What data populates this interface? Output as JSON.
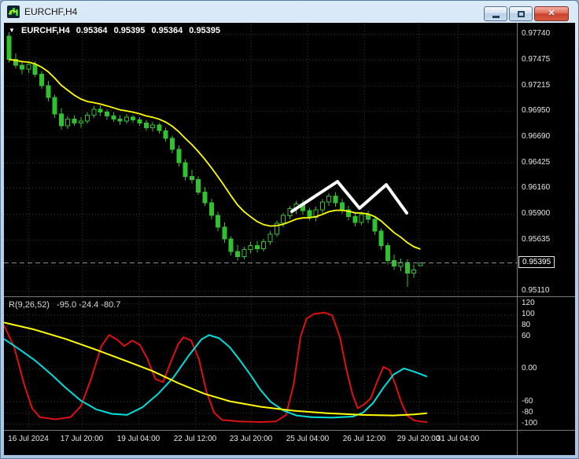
{
  "window": {
    "title": "EURCHF,H4",
    "controls": {
      "minimize": "minimize-button",
      "maximize": "maximize-button",
      "close": "close-button"
    }
  },
  "main_chart": {
    "marker": "▼",
    "symbol_label": "EURCHF,H4",
    "open": "0.95364",
    "high": "0.95395",
    "low": "0.95364",
    "close": "0.95395",
    "current_price_label": "0.95395"
  },
  "indicator_panel": {
    "label": "R(9,26,52)",
    "values": "-95.0 -24.4 -80.7"
  },
  "colors": {
    "bull": "#30c030",
    "ma": "#ffff00",
    "annotation": "#ffffff",
    "ind_fast": "#dd1111",
    "ind_mid": "#00dddd",
    "ind_slow": "#ffff00"
  },
  "chart_data": [
    {
      "type": "candlestick",
      "title": "EURCHF H4",
      "ylim": [
        0.9506,
        0.9784
      ],
      "price_ticks": [
        0.9774,
        0.97475,
        0.97215,
        0.9695,
        0.9669,
        0.96425,
        0.9616,
        0.959,
        0.95635,
        0.9537,
        0.9511
      ],
      "current_price": 0.95395,
      "ma_alpha": 0.15,
      "time_labels": [
        {
          "x": 0.048,
          "label": "16 Jul 2024"
        },
        {
          "x": 0.152,
          "label": "17 Jul 20:00"
        },
        {
          "x": 0.262,
          "label": "19 Jul 04:00"
        },
        {
          "x": 0.372,
          "label": "22 Jul 12:00"
        },
        {
          "x": 0.482,
          "label": "23 Jul 20:00"
        },
        {
          "x": 0.592,
          "label": "25 Jul 04:00"
        },
        {
          "x": 0.702,
          "label": "26 Jul 12:00"
        },
        {
          "x": 0.808,
          "label": "29 Jul 20:00"
        },
        {
          "x": 0.885,
          "label": "31 Jul 04:00"
        }
      ],
      "annotation_zigzag": [
        [
          366,
          238
        ],
        [
          424,
          200
        ],
        [
          452,
          234
        ],
        [
          486,
          204
        ],
        [
          512,
          240
        ]
      ],
      "candles": [
        [
          0.9772,
          0.9776,
          0.9745,
          0.9748
        ],
        [
          0.9748,
          0.9754,
          0.9739,
          0.9742
        ],
        [
          0.9742,
          0.9747,
          0.9733,
          0.9738
        ],
        [
          0.9738,
          0.9745,
          0.9734,
          0.9743
        ],
        [
          0.9743,
          0.9746,
          0.973,
          0.9733
        ],
        [
          0.9733,
          0.9736,
          0.9718,
          0.9721
        ],
        [
          0.9721,
          0.9726,
          0.9705,
          0.9709
        ],
        [
          0.9709,
          0.9712,
          0.9688,
          0.9692
        ],
        [
          0.9692,
          0.9698,
          0.9676,
          0.968
        ],
        [
          0.968,
          0.969,
          0.9677,
          0.9687
        ],
        [
          0.9687,
          0.9691,
          0.968,
          0.9683
        ],
        [
          0.9683,
          0.9689,
          0.9678,
          0.9685
        ],
        [
          0.9685,
          0.9694,
          0.9682,
          0.9691
        ],
        [
          0.9691,
          0.97,
          0.9688,
          0.9697
        ],
        [
          0.9697,
          0.9701,
          0.969,
          0.9694
        ],
        [
          0.9694,
          0.9697,
          0.9686,
          0.969
        ],
        [
          0.969,
          0.9694,
          0.9684,
          0.9687
        ],
        [
          0.9687,
          0.9691,
          0.9681,
          0.9685
        ],
        [
          0.9685,
          0.9692,
          0.9682,
          0.9689
        ],
        [
          0.9689,
          0.9691,
          0.9683,
          0.9686
        ],
        [
          0.9686,
          0.9689,
          0.968,
          0.9683
        ],
        [
          0.9683,
          0.9686,
          0.9675,
          0.9678
        ],
        [
          0.9678,
          0.9684,
          0.9674,
          0.9681
        ],
        [
          0.9681,
          0.9683,
          0.9672,
          0.9675
        ],
        [
          0.9675,
          0.9678,
          0.9664,
          0.9667
        ],
        [
          0.9667,
          0.967,
          0.9652,
          0.9656
        ],
        [
          0.9656,
          0.966,
          0.9638,
          0.9642
        ],
        [
          0.9642,
          0.9646,
          0.9624,
          0.9628
        ],
        [
          0.9628,
          0.9635,
          0.9621,
          0.9625
        ],
        [
          0.9625,
          0.9628,
          0.9609,
          0.9612
        ],
        [
          0.9612,
          0.9617,
          0.9598,
          0.9601
        ],
        [
          0.9601,
          0.9605,
          0.9584,
          0.9588
        ],
        [
          0.9588,
          0.9592,
          0.9572,
          0.9576
        ],
        [
          0.9576,
          0.9581,
          0.956,
          0.9564
        ],
        [
          0.9564,
          0.9567,
          0.9547,
          0.9551
        ],
        [
          0.9551,
          0.9558,
          0.9542,
          0.9546
        ],
        [
          0.9546,
          0.9556,
          0.9543,
          0.9553
        ],
        [
          0.9553,
          0.9561,
          0.9549,
          0.9557
        ],
        [
          0.9557,
          0.9562,
          0.955,
          0.9554
        ],
        [
          0.9554,
          0.9564,
          0.9551,
          0.9561
        ],
        [
          0.9561,
          0.9572,
          0.9558,
          0.9569
        ],
        [
          0.9569,
          0.9583,
          0.9566,
          0.958
        ],
        [
          0.958,
          0.9591,
          0.9576,
          0.9588
        ],
        [
          0.9588,
          0.9598,
          0.9584,
          0.9595
        ],
        [
          0.9595,
          0.9603,
          0.959,
          0.96
        ],
        [
          0.96,
          0.9604,
          0.9589,
          0.9593
        ],
        [
          0.9593,
          0.9596,
          0.9583,
          0.9586
        ],
        [
          0.9586,
          0.9597,
          0.9582,
          0.9594
        ],
        [
          0.9594,
          0.9605,
          0.959,
          0.9602
        ],
        [
          0.9602,
          0.9611,
          0.9598,
          0.9608
        ],
        [
          0.9608,
          0.9612,
          0.9597,
          0.9601
        ],
        [
          0.9601,
          0.9605,
          0.959,
          0.9594
        ],
        [
          0.9594,
          0.9598,
          0.9583,
          0.9587
        ],
        [
          0.9587,
          0.9591,
          0.9577,
          0.9581
        ],
        [
          0.9581,
          0.9592,
          0.9578,
          0.9589
        ],
        [
          0.9589,
          0.9593,
          0.958,
          0.9584
        ],
        [
          0.9584,
          0.9587,
          0.9568,
          0.9572
        ],
        [
          0.9572,
          0.9575,
          0.9553,
          0.9557
        ],
        [
          0.9557,
          0.956,
          0.9538,
          0.9542
        ],
        [
          0.9542,
          0.9548,
          0.9532,
          0.9536
        ],
        [
          0.9536,
          0.9544,
          0.9531,
          0.954
        ],
        [
          0.954,
          0.9543,
          0.9515,
          0.9529
        ],
        [
          0.9529,
          0.9538,
          0.9524,
          0.9532
        ],
        [
          0.95364,
          0.95395,
          0.95364,
          0.95395
        ]
      ]
    },
    {
      "type": "line",
      "title": "R(9,26,52)",
      "current_values": [
        -95.0,
        -24.4,
        -80.7
      ],
      "ylim": [
        -110,
        130
      ],
      "ticks": [
        {
          "value": 120,
          "label": "120"
        },
        {
          "value": 100,
          "label": "100"
        },
        {
          "value": 80,
          "label": "80"
        },
        {
          "value": 60,
          "label": "60"
        },
        {
          "value": 0,
          "label": "0.00"
        },
        {
          "value": -60,
          "label": "-60"
        },
        {
          "value": -80,
          "label": "-80"
        },
        {
          "value": -100,
          "label": "-100"
        }
      ],
      "series": [
        {
          "name": "fast-red",
          "color": "#dd1111",
          "points": [
            [
              0,
              80
            ],
            [
              0.02,
              40
            ],
            [
              0.04,
              -30
            ],
            [
              0.055,
              -72
            ],
            [
              0.07,
              -88
            ],
            [
              0.1,
              -92
            ],
            [
              0.13,
              -88
            ],
            [
              0.15,
              -68
            ],
            [
              0.17,
              -18
            ],
            [
              0.19,
              42
            ],
            [
              0.205,
              62
            ],
            [
              0.22,
              54
            ],
            [
              0.235,
              42
            ],
            [
              0.25,
              52
            ],
            [
              0.265,
              44
            ],
            [
              0.28,
              18
            ],
            [
              0.295,
              -18
            ],
            [
              0.31,
              -24
            ],
            [
              0.325,
              12
            ],
            [
              0.34,
              46
            ],
            [
              0.35,
              58
            ],
            [
              0.365,
              52
            ],
            [
              0.38,
              18
            ],
            [
              0.395,
              -42
            ],
            [
              0.41,
              -80
            ],
            [
              0.425,
              -93
            ],
            [
              0.46,
              -96
            ],
            [
              0.5,
              -97
            ],
            [
              0.53,
              -96
            ],
            [
              0.55,
              -84
            ],
            [
              0.565,
              -28
            ],
            [
              0.578,
              58
            ],
            [
              0.59,
              92
            ],
            [
              0.605,
              101
            ],
            [
              0.625,
              103
            ],
            [
              0.64,
              98
            ],
            [
              0.655,
              58
            ],
            [
              0.668,
              -2
            ],
            [
              0.68,
              -48
            ],
            [
              0.69,
              -72
            ],
            [
              0.703,
              -64
            ],
            [
              0.715,
              -54
            ],
            [
              0.728,
              -22
            ],
            [
              0.74,
              4
            ],
            [
              0.752,
              -2
            ],
            [
              0.763,
              -28
            ],
            [
              0.775,
              -62
            ],
            [
              0.787,
              -86
            ],
            [
              0.8,
              -94
            ],
            [
              0.812,
              -96
            ],
            [
              0.825,
              -97
            ]
          ]
        },
        {
          "name": "mid-cyan",
          "color": "#00dddd",
          "points": [
            [
              0,
              55
            ],
            [
              0.03,
              36
            ],
            [
              0.06,
              16
            ],
            [
              0.09,
              -8
            ],
            [
              0.12,
              -34
            ],
            [
              0.15,
              -58
            ],
            [
              0.18,
              -74
            ],
            [
              0.21,
              -82
            ],
            [
              0.24,
              -84
            ],
            [
              0.27,
              -70
            ],
            [
              0.3,
              -46
            ],
            [
              0.33,
              -16
            ],
            [
              0.36,
              24
            ],
            [
              0.385,
              54
            ],
            [
              0.4,
              62
            ],
            [
              0.42,
              56
            ],
            [
              0.44,
              40
            ],
            [
              0.46,
              16
            ],
            [
              0.48,
              -10
            ],
            [
              0.5,
              -38
            ],
            [
              0.52,
              -60
            ],
            [
              0.545,
              -76
            ],
            [
              0.57,
              -85
            ],
            [
              0.6,
              -88
            ],
            [
              0.64,
              -89
            ],
            [
              0.68,
              -87
            ],
            [
              0.7,
              -80
            ],
            [
              0.72,
              -62
            ],
            [
              0.74,
              -34
            ],
            [
              0.76,
              -10
            ],
            [
              0.78,
              1
            ],
            [
              0.8,
              -5
            ],
            [
              0.825,
              -14
            ]
          ]
        },
        {
          "name": "slow-yellow",
          "color": "#ffff00",
          "points": [
            [
              0,
              85
            ],
            [
              0.06,
              72
            ],
            [
              0.12,
              55
            ],
            [
              0.18,
              35
            ],
            [
              0.24,
              14
            ],
            [
              0.29,
              -4
            ],
            [
              0.34,
              -26
            ],
            [
              0.39,
              -45
            ],
            [
              0.44,
              -59
            ],
            [
              0.5,
              -69
            ],
            [
              0.56,
              -76
            ],
            [
              0.63,
              -81
            ],
            [
              0.7,
              -84
            ],
            [
              0.76,
              -85
            ],
            [
              0.8,
              -83
            ],
            [
              0.825,
              -81
            ]
          ]
        }
      ]
    }
  ]
}
